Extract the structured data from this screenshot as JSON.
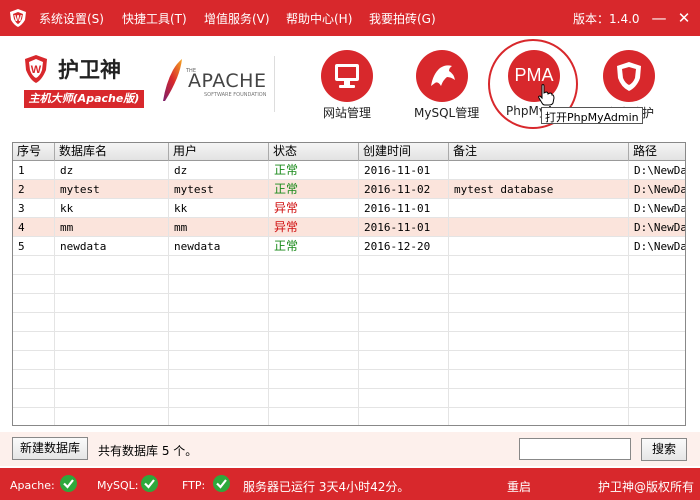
{
  "menu": {
    "items": [
      "系统设置(S)",
      "快捷工具(T)",
      "增值服务(V)",
      "帮助中心(H)",
      "我要拍砖(G)"
    ],
    "version": "版本：1.4.0"
  },
  "brand": {
    "title": "护卫神",
    "subtitle": "主机大师(Apache版)",
    "apache_the": "THE",
    "apache_word": "APACHE",
    "apache_sub": "SOFTWARE FOUNDATION"
  },
  "toolbar": {
    "site": "网站管理",
    "mysql": "MySQL管理",
    "pma_icon_text": "PMA",
    "pma_label": "PhpMyA",
    "security": "安全防护",
    "tooltip": "打开PhpMyAdmin"
  },
  "table": {
    "columns": [
      "序号",
      "数据库名",
      "用户",
      "状态",
      "创建时间",
      "备注",
      "路径"
    ],
    "rows": [
      {
        "id": "1",
        "db": "dz",
        "user": "dz",
        "status": "正常",
        "ok": true,
        "created": "2016-11-01",
        "note": "",
        "path": "D:\\NewData"
      },
      {
        "id": "2",
        "db": "mytest",
        "user": "mytest",
        "status": "正常",
        "ok": true,
        "created": "2016-11-02",
        "note": "mytest database",
        "path": "D:\\NewData"
      },
      {
        "id": "3",
        "db": "kk",
        "user": "kk",
        "status": "异常",
        "ok": false,
        "created": "2016-11-01",
        "note": "",
        "path": "D:\\NewData"
      },
      {
        "id": "4",
        "db": "mm",
        "user": "mm",
        "status": "异常",
        "ok": false,
        "created": "2016-11-01",
        "note": "",
        "path": "D:\\NewData"
      },
      {
        "id": "5",
        "db": "newdata",
        "user": "newdata",
        "status": "正常",
        "ok": true,
        "created": "2016-12-20",
        "note": "",
        "path": "D:\\NewData"
      }
    ]
  },
  "bottom": {
    "new_db": "新建数据库",
    "count_text": "共有数据库 5 个。",
    "search_value": "",
    "search_btn": "搜索"
  },
  "status": {
    "apache": "Apache:",
    "mysql": "MySQL:",
    "ftp": "FTP:",
    "uptime": "服务器已运行 3天4小时42分。",
    "restart": "重启",
    "copyright": "护卫神@版权所有"
  },
  "colors": {
    "brand_red": "#d8282c",
    "ok_green": "#1a8a1a",
    "err_red": "#d01010",
    "alt_row": "#fbe4dc"
  }
}
